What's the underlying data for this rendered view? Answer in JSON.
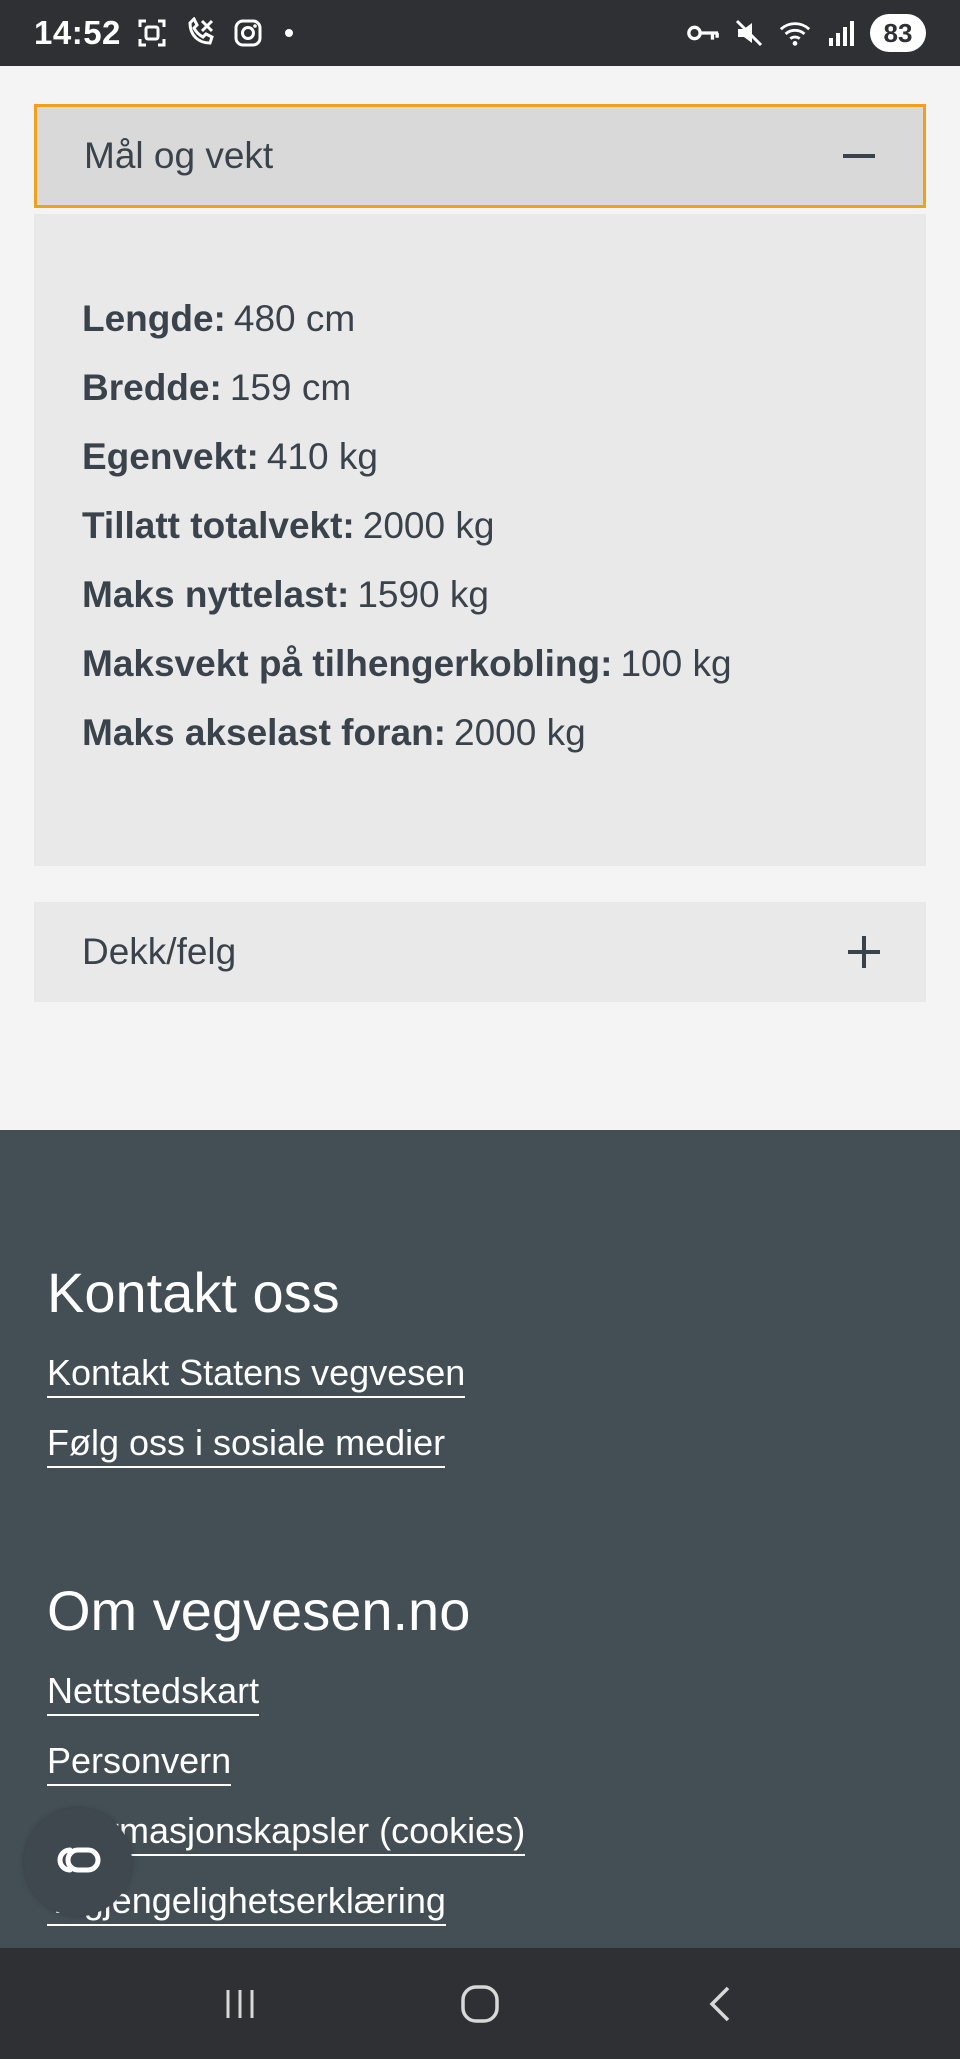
{
  "status_bar": {
    "time": "14:52",
    "battery": "83",
    "icons": [
      "screenshot-icon",
      "missed-call-icon",
      "instagram-icon",
      "notification-dot",
      "vpn-key-icon",
      "mute-icon",
      "wifi-icon",
      "signal-icon",
      "battery-icon"
    ]
  },
  "accordion": [
    {
      "title": "Mål og vekt",
      "expanded": true,
      "toggle_icon": "minus-icon",
      "rows": [
        {
          "label": "Lengde:",
          "value": "480 cm"
        },
        {
          "label": "Bredde:",
          "value": "159 cm"
        },
        {
          "label": "Egenvekt:",
          "value": "410 kg"
        },
        {
          "label": "Tillatt totalvekt:",
          "value": "2000 kg"
        },
        {
          "label": "Maks nyttelast:",
          "value": "1590 kg"
        },
        {
          "label": "Maksvekt på tilhengerkobling:",
          "value": "100 kg"
        },
        {
          "label": "Maks akselast foran:",
          "value": "2000 kg"
        }
      ]
    },
    {
      "title": "Dekk/felg",
      "expanded": false,
      "toggle_icon": "plus-icon"
    }
  ],
  "footer": {
    "contact_heading": "Kontakt oss",
    "contact_links": [
      "Kontakt Statens vegvesen",
      "Følg oss i sosiale medier"
    ],
    "about_heading": "Om vegvesen.no",
    "about_links": [
      "Nettstedskart",
      "Personvern",
      "Informasjonskapsler (cookies)",
      "Tilgjengelighetserklæring"
    ]
  },
  "cookie_button": {
    "icon": "cookie-settings-icon"
  },
  "nav_bar": {
    "icons": [
      "recent-apps-icon",
      "home-icon",
      "back-icon"
    ]
  },
  "colors": {
    "accent_focus": "#f0a11b",
    "footer_bg": "#444f55",
    "text": "#3a434b",
    "system_bar": "#2f3034"
  }
}
